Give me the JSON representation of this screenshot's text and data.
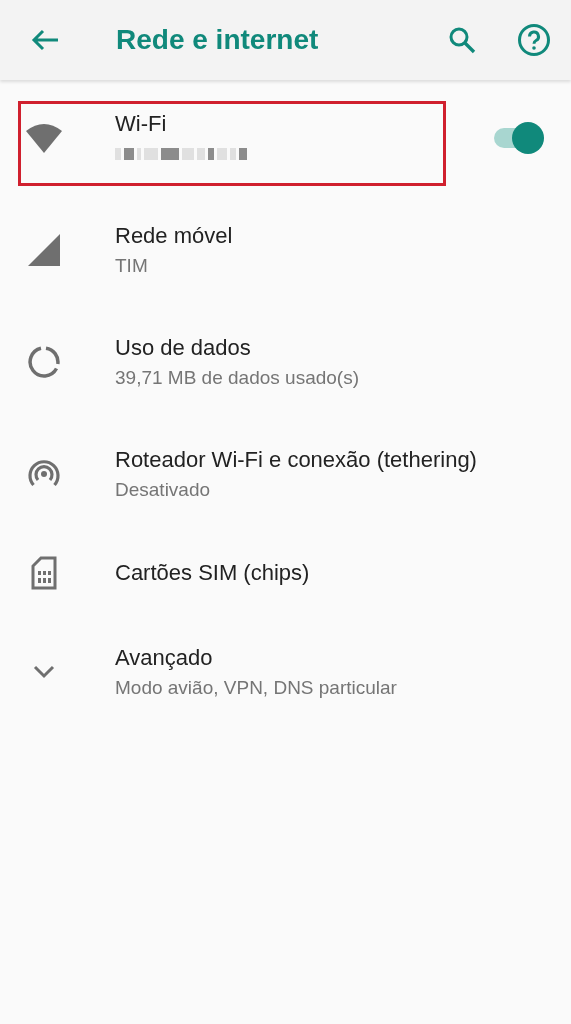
{
  "app_bar": {
    "title": "Rede e internet"
  },
  "items": [
    {
      "title": "Wi-Fi",
      "subtitle_obscured": true,
      "switch": {
        "on": true
      },
      "highlighted": true
    },
    {
      "title": "Rede móvel",
      "subtitle": "TIM"
    },
    {
      "title": "Uso de dados",
      "subtitle": "39,71 MB de dados usado(s)"
    },
    {
      "title": "Roteador Wi-Fi e conexão (tethering)",
      "subtitle": "Desativado"
    },
    {
      "title": "Cartões SIM (chips)"
    },
    {
      "title": "Avançado",
      "subtitle": "Modo avião, VPN, DNS particular"
    }
  ]
}
